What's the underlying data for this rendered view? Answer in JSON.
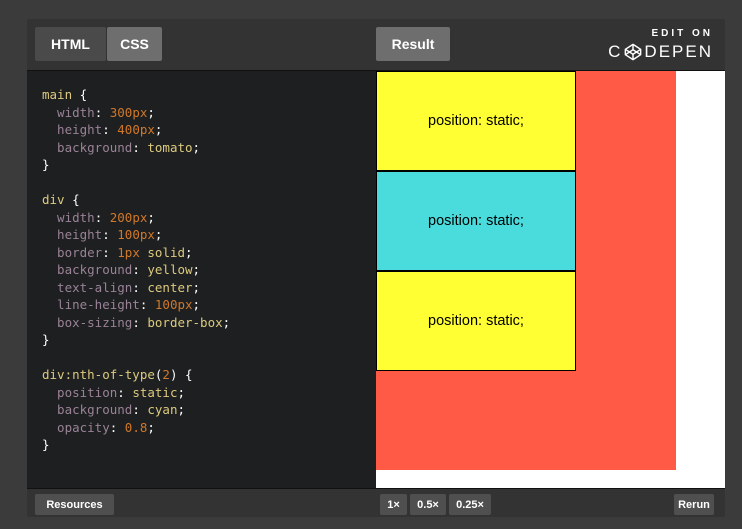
{
  "tabs": {
    "html": "HTML",
    "css": "CSS",
    "result": "Result"
  },
  "branding": {
    "edit_on": "EDIT ON",
    "logo": "CODEPEN"
  },
  "code_lines": [
    [
      {
        "t": "main",
        "c": "sel"
      },
      {
        "t": " {",
        "c": "punc"
      }
    ],
    [
      {
        "t": "  width",
        "c": "prop"
      },
      {
        "t": ": ",
        "c": "punc"
      },
      {
        "t": "300px",
        "c": "num"
      },
      {
        "t": ";",
        "c": "punc"
      }
    ],
    [
      {
        "t": "  height",
        "c": "prop"
      },
      {
        "t": ": ",
        "c": "punc"
      },
      {
        "t": "400px",
        "c": "num"
      },
      {
        "t": ";",
        "c": "punc"
      }
    ],
    [
      {
        "t": "  background",
        "c": "prop"
      },
      {
        "t": ": ",
        "c": "punc"
      },
      {
        "t": "tomato",
        "c": "val"
      },
      {
        "t": ";",
        "c": "punc"
      }
    ],
    [
      {
        "t": "}",
        "c": "punc"
      }
    ],
    [],
    [
      {
        "t": "div",
        "c": "sel"
      },
      {
        "t": " {",
        "c": "punc"
      }
    ],
    [
      {
        "t": "  width",
        "c": "prop"
      },
      {
        "t": ": ",
        "c": "punc"
      },
      {
        "t": "200px",
        "c": "num"
      },
      {
        "t": ";",
        "c": "punc"
      }
    ],
    [
      {
        "t": "  height",
        "c": "prop"
      },
      {
        "t": ": ",
        "c": "punc"
      },
      {
        "t": "100px",
        "c": "num"
      },
      {
        "t": ";",
        "c": "punc"
      }
    ],
    [
      {
        "t": "  border",
        "c": "prop"
      },
      {
        "t": ": ",
        "c": "punc"
      },
      {
        "t": "1px",
        "c": "num"
      },
      {
        "t": " ",
        "c": "punc"
      },
      {
        "t": "solid",
        "c": "val"
      },
      {
        "t": ";",
        "c": "punc"
      }
    ],
    [
      {
        "t": "  background",
        "c": "prop"
      },
      {
        "t": ": ",
        "c": "punc"
      },
      {
        "t": "yellow",
        "c": "val"
      },
      {
        "t": ";",
        "c": "punc"
      }
    ],
    [
      {
        "t": "  text-align",
        "c": "prop"
      },
      {
        "t": ": ",
        "c": "punc"
      },
      {
        "t": "center",
        "c": "val"
      },
      {
        "t": ";",
        "c": "punc"
      }
    ],
    [
      {
        "t": "  line-height",
        "c": "prop"
      },
      {
        "t": ": ",
        "c": "punc"
      },
      {
        "t": "100px",
        "c": "num"
      },
      {
        "t": ";",
        "c": "punc"
      }
    ],
    [
      {
        "t": "  box-sizing",
        "c": "prop"
      },
      {
        "t": ": ",
        "c": "punc"
      },
      {
        "t": "border-box",
        "c": "val"
      },
      {
        "t": ";",
        "c": "punc"
      }
    ],
    [
      {
        "t": "}",
        "c": "punc"
      }
    ],
    [],
    [
      {
        "t": "div:nth-of-type",
        "c": "sel"
      },
      {
        "t": "(",
        "c": "punc"
      },
      {
        "t": "2",
        "c": "num"
      },
      {
        "t": ") {",
        "c": "punc"
      }
    ],
    [
      {
        "t": "  position",
        "c": "prop"
      },
      {
        "t": ": ",
        "c": "punc"
      },
      {
        "t": "static",
        "c": "val"
      },
      {
        "t": ";",
        "c": "punc"
      }
    ],
    [
      {
        "t": "  background",
        "c": "prop"
      },
      {
        "t": ": ",
        "c": "punc"
      },
      {
        "t": "cyan",
        "c": "val"
      },
      {
        "t": ";",
        "c": "punc"
      }
    ],
    [
      {
        "t": "  opacity",
        "c": "prop"
      },
      {
        "t": ": ",
        "c": "punc"
      },
      {
        "t": "0.8",
        "c": "num"
      },
      {
        "t": ";",
        "c": "punc"
      }
    ],
    [
      {
        "t": "}",
        "c": "punc"
      }
    ]
  ],
  "result_boxes": [
    {
      "label": "position: static;",
      "variant": "yellow"
    },
    {
      "label": "position: static;",
      "variant": "cyan"
    },
    {
      "label": "position: static;",
      "variant": "yellow"
    }
  ],
  "footer": {
    "resources": "Resources",
    "zoom_1x": "1×",
    "zoom_05x": "0.5×",
    "zoom_025x": "0.25×",
    "rerun": "Rerun"
  },
  "colors": {
    "tomato": "#ff5a45",
    "yellow": "#ffff33",
    "cyan": "#4adcdc",
    "selector": "#ddca7e",
    "property": "#9a8297",
    "number": "#d0782a"
  }
}
